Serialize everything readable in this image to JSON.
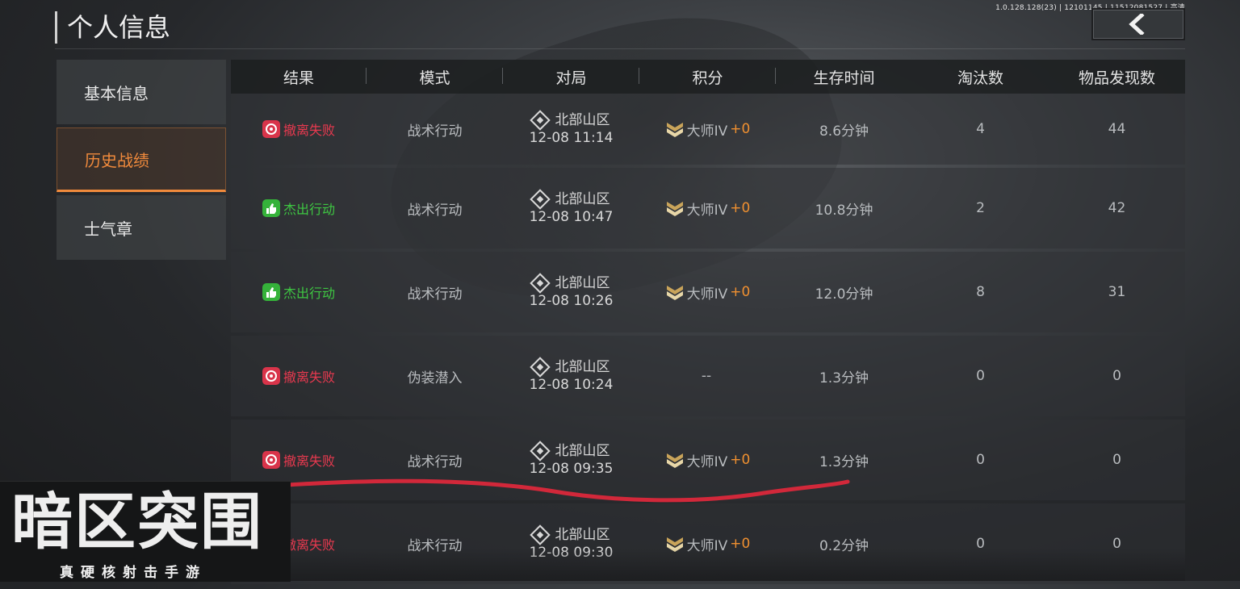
{
  "build_info": "1.0.128.128(23) | 12101145 | 11512081527 | 高清",
  "title": "个人信息",
  "colors": {
    "accent": "#f08a3c",
    "fail": "#e8394f",
    "success": "#3ec742",
    "plus": "#f09030"
  },
  "back_button": {
    "icon": "back-arrow-icon"
  },
  "sidebar": {
    "items": [
      {
        "label": "基本信息",
        "active": false
      },
      {
        "label": "历史战绩",
        "active": true
      },
      {
        "label": "士气章",
        "active": false
      }
    ]
  },
  "table": {
    "headers": [
      "结果",
      "模式",
      "对局",
      "积分",
      "生存时间",
      "淘汰数",
      "物品发现数"
    ],
    "rows": [
      {
        "result": "撤离失败",
        "status": "fail",
        "mode": "战术行动",
        "map": "北部山区",
        "time": "12-08 11:14",
        "rank": "大师IV",
        "plus": "+0",
        "survival": "8.6分钟",
        "eliminations": "4",
        "items": "44"
      },
      {
        "result": "杰出行动",
        "status": "success",
        "mode": "战术行动",
        "map": "北部山区",
        "time": "12-08 10:47",
        "rank": "大师IV",
        "plus": "+0",
        "survival": "10.8分钟",
        "eliminations": "2",
        "items": "42"
      },
      {
        "result": "杰出行动",
        "status": "success",
        "mode": "战术行动",
        "map": "北部山区",
        "time": "12-08 10:26",
        "rank": "大师IV",
        "plus": "+0",
        "survival": "12.0分钟",
        "eliminations": "8",
        "items": "31"
      },
      {
        "result": "撤离失败",
        "status": "fail",
        "mode": "伪装潜入",
        "map": "北部山区",
        "time": "12-08 10:24",
        "rank": "--",
        "plus": "",
        "survival": "1.3分钟",
        "eliminations": "0",
        "items": "0"
      },
      {
        "result": "撤离失败",
        "status": "fail",
        "mode": "战术行动",
        "map": "北部山区",
        "time": "12-08 09:35",
        "rank": "大师IV",
        "plus": "+0",
        "survival": "1.3分钟",
        "eliminations": "0",
        "items": "0"
      },
      {
        "result": "撤离失败",
        "status": "fail",
        "mode": "战术行动",
        "map": "北部山区",
        "time": "12-08 09:30",
        "rank": "大师IV",
        "plus": "+0",
        "survival": "0.2分钟",
        "eliminations": "0",
        "items": "0"
      }
    ]
  },
  "watermark": {
    "main": "暗区突围",
    "sub": "真硬核射击手游"
  }
}
